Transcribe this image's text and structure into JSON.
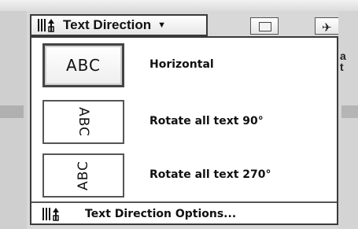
{
  "ribbon": {
    "text_direction_button": {
      "label": "Text Direction",
      "icon": "text-direction-icon",
      "caret_icon": "caret-down-icon"
    },
    "neighbor_buttons": [
      {
        "icon": "frame-icon"
      },
      {
        "icon": "pin-icon"
      }
    ],
    "side_glyphs": "a\nt"
  },
  "menu": {
    "items": [
      {
        "label": "Horizontal",
        "preview_text": "ABC",
        "orientation": "horizontal",
        "selected": true
      },
      {
        "label": "Rotate all text 90°",
        "preview_text": "ABC",
        "orientation": "rotate-90",
        "selected": false
      },
      {
        "label": "Rotate all text 270°",
        "preview_text": "ABC",
        "orientation": "rotate-270",
        "selected": false
      }
    ],
    "footer": {
      "label": "Text Direction Options...",
      "icon": "text-direction-icon"
    }
  },
  "colors": {
    "border": "#3a3a3a",
    "menu_background": "#ffffff",
    "chrome_background": "#d8d8d8"
  }
}
